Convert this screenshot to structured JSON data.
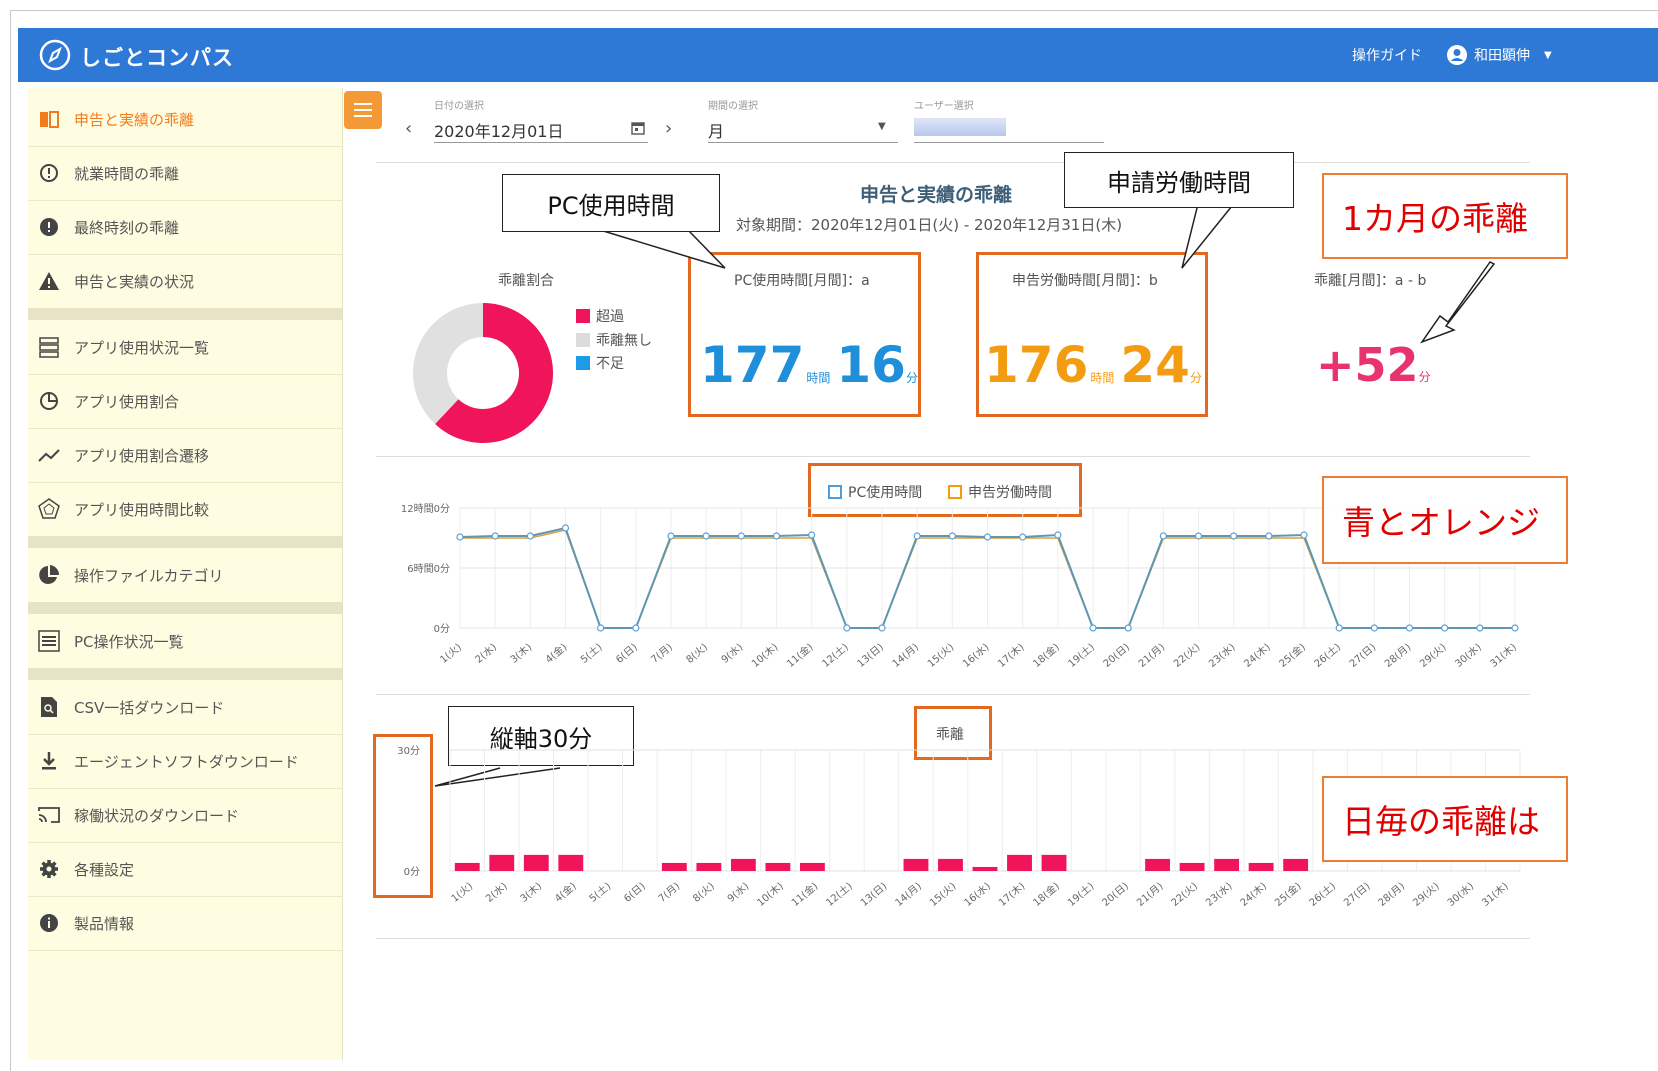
{
  "app": {
    "title": "しごとコンパス"
  },
  "header": {
    "guide_label": "操作ガイド",
    "user_name": "和田顕伸"
  },
  "sidebar": {
    "items": [
      {
        "label": "申告と実績の乖離",
        "icon": "split-icon",
        "active": true
      },
      {
        "label": "就業時間の乖離",
        "icon": "alert-circle-outline-icon"
      },
      {
        "label": "最終時刻の乖離",
        "icon": "alert-circle-filled-icon"
      },
      {
        "label": "申告と実績の状況",
        "icon": "warning-triangle-icon"
      },
      {
        "label": "アプリ使用状況一覧",
        "icon": "list-boxes-icon"
      },
      {
        "label": "アプリ使用割合",
        "icon": "pie-icon"
      },
      {
        "label": "アプリ使用割合遷移",
        "icon": "trend-line-icon"
      },
      {
        "label": "アプリ使用時間比較",
        "icon": "radar-icon"
      },
      {
        "label": "操作ファイルカテゴリ",
        "icon": "pie-filled-icon"
      },
      {
        "label": "PC操作状況一覧",
        "icon": "list-lines-icon"
      },
      {
        "label": "CSV一括ダウンロード",
        "icon": "file-search-icon"
      },
      {
        "label": "エージェントソフトダウンロード",
        "icon": "download-icon"
      },
      {
        "label": "稼働状況のダウンロード",
        "icon": "cast-icon"
      },
      {
        "label": "各種設定",
        "icon": "gear-icon"
      },
      {
        "label": "製品情報",
        "icon": "info-icon"
      }
    ]
  },
  "filters": {
    "date_label": "日付の選択",
    "date_value": "2020年12月01日",
    "period_label": "期間の選択",
    "period_value": "月",
    "user_label": "ユーザー選択"
  },
  "summary": {
    "title": "申告と実績の乖離",
    "period": "対象期間：2020年12月01日(火) - 2020年12月31日(木)",
    "ratio_title": "乖離割合",
    "legend": [
      "超過",
      "乖離無し",
      "不足"
    ],
    "colors": {
      "over": "#f0145a",
      "none": "#e0e0e0",
      "short": "#1e9be8",
      "pc": "#1e8fd8",
      "report": "#f39c12",
      "diff": "#e8336c"
    },
    "donut": {
      "over": 0.62,
      "none": 0.38,
      "short": 0.0
    },
    "pc_label": "PC使用時間[月間]：a",
    "pc_hours": "177",
    "pc_minutes": "16",
    "report_label": "申告労働時間[月間]：b",
    "report_hours": "176",
    "report_minutes": "24",
    "diff_label": "乖離[月間]：a - b",
    "diff_value": "+52",
    "unit_hour": "時間",
    "unit_min": "分"
  },
  "callouts": {
    "pc": "PC使用時間",
    "report": "申請労働時間",
    "axis": "縦軸30分",
    "monthly": "1カ月の乖離",
    "lines": "青とオレンジ",
    "daily": "日毎の乖離は"
  },
  "chart_data": [
    {
      "type": "line",
      "legend": [
        "PC使用時間",
        "申告労働時間"
      ],
      "ytick_labels": [
        "12時間0分",
        "6時間0分",
        "0分"
      ],
      "ylim": [
        0,
        12
      ],
      "categories": [
        "1(火)",
        "2(水)",
        "3(木)",
        "4(金)",
        "5(土)",
        "6(日)",
        "7(月)",
        "8(火)",
        "9(水)",
        "10(木)",
        "11(金)",
        "12(土)",
        "13(日)",
        "14(月)",
        "15(火)",
        "16(水)",
        "17(木)",
        "18(金)",
        "19(土)",
        "20(日)",
        "21(月)",
        "22(火)",
        "23(水)",
        "24(木)",
        "25(金)",
        "26(土)",
        "27(日)",
        "28(月)",
        "29(火)",
        "30(水)",
        "31(木)"
      ],
      "series": [
        {
          "name": "PC使用時間",
          "values": [
            9.1,
            9.2,
            9.2,
            10.0,
            0,
            0,
            9.2,
            9.2,
            9.2,
            9.2,
            9.3,
            0,
            0,
            9.2,
            9.2,
            9.1,
            9.1,
            9.3,
            0,
            0,
            9.2,
            9.2,
            9.2,
            9.2,
            9.3,
            0,
            0,
            0,
            0,
            0,
            0
          ]
        },
        {
          "name": "申告労働時間",
          "values": [
            9.0,
            9.0,
            9.0,
            9.8,
            0,
            0,
            9.0,
            9.0,
            9.0,
            9.0,
            9.0,
            0,
            0,
            9.0,
            9.0,
            9.0,
            9.0,
            9.0,
            0,
            0,
            9.0,
            9.0,
            9.0,
            9.0,
            9.0,
            0,
            0,
            0,
            0,
            0,
            0
          ]
        }
      ]
    },
    {
      "type": "bar",
      "title": "乖離",
      "ytick_labels": [
        "30分",
        "0分"
      ],
      "ylim": [
        0,
        30
      ],
      "categories": [
        "1(火)",
        "2(水)",
        "3(木)",
        "4(金)",
        "5(土)",
        "6(日)",
        "7(月)",
        "8(火)",
        "9(水)",
        "10(木)",
        "11(金)",
        "12(土)",
        "13(日)",
        "14(月)",
        "15(火)",
        "16(水)",
        "17(木)",
        "18(金)",
        "19(土)",
        "20(日)",
        "21(月)",
        "22(火)",
        "23(水)",
        "24(木)",
        "25(金)",
        "26(土)",
        "27(日)",
        "28(月)",
        "29(火)",
        "30(水)",
        "31(木)"
      ],
      "values": [
        2,
        4,
        4,
        4,
        0,
        0,
        2,
        2,
        3,
        2,
        2,
        0,
        0,
        3,
        3,
        1,
        4,
        4,
        0,
        0,
        3,
        2,
        3,
        2,
        3,
        0,
        0,
        0,
        0,
        0,
        0
      ]
    }
  ]
}
